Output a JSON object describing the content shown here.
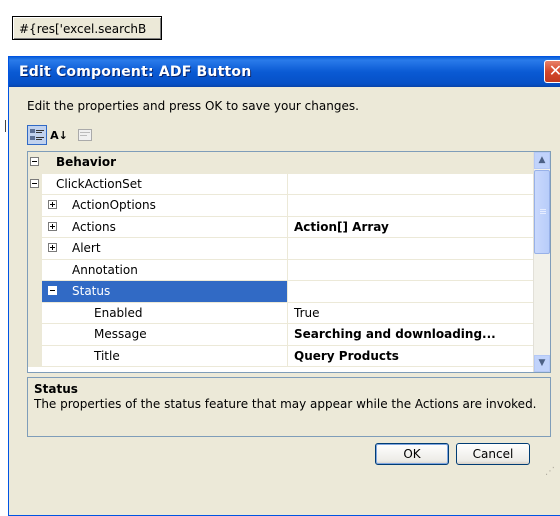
{
  "background": {
    "cell_button_text": "#{res['excel.searchB"
  },
  "dialog": {
    "title": "Edit Component: ADF Button",
    "close_glyph": "✕",
    "instructions": "Edit the properties and press OK to save your changes.",
    "toolbar": {
      "categorized_icon": "categorized-icon",
      "alphabetical_label": "A↓",
      "property_pages_icon": "property-pages-icon"
    },
    "grid": {
      "rows": [
        {
          "kind": "category",
          "expander": "⊟",
          "name": "Behavior",
          "value": ""
        },
        {
          "kind": "group",
          "expander": "⊟",
          "name": "ClickActionSet",
          "value": ""
        },
        {
          "kind": "child",
          "expander": "⊞",
          "name": "ActionOptions",
          "value": ""
        },
        {
          "kind": "child",
          "expander": "⊞",
          "name": "Actions",
          "value": "Action[] Array"
        },
        {
          "kind": "child",
          "expander": "⊞",
          "name": "Alert",
          "value": ""
        },
        {
          "kind": "child",
          "expander": "",
          "name": "Annotation",
          "value": ""
        },
        {
          "kind": "child-selected",
          "expander": "⊟",
          "name": "Status",
          "value": ""
        },
        {
          "kind": "grandchild",
          "expander": "",
          "name": "Enabled",
          "value": "True"
        },
        {
          "kind": "grandchild",
          "expander": "",
          "name": "Message",
          "value": "Searching and downloading..."
        },
        {
          "kind": "grandchild",
          "expander": "",
          "name": "Title",
          "value": "Query Products"
        }
      ]
    },
    "description": {
      "title": "Status",
      "text": "The properties of the status feature that may appear while the Actions are invoked."
    },
    "ok_label": "OK",
    "cancel_label": "Cancel"
  }
}
